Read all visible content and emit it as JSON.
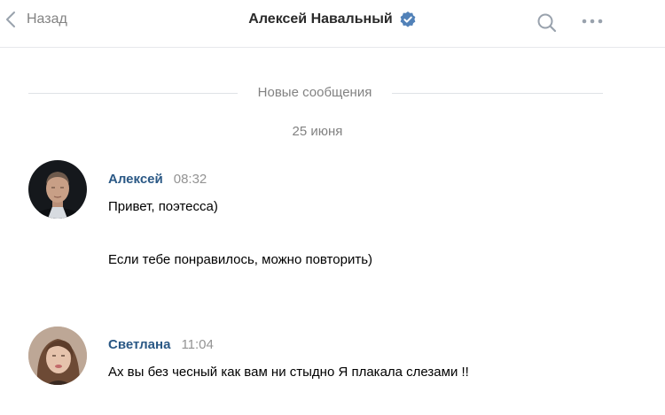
{
  "header": {
    "back_label": "Назад",
    "back_icon": "chevron-left-icon",
    "title": "Алексей Навальный",
    "verified_icon": "verified-badge-icon",
    "search_icon": "search-icon",
    "more_icon": "more-dots-icon"
  },
  "divider": {
    "label": "Новые сообщения"
  },
  "date": "25 июня",
  "messages": [
    {
      "author": "Алексей",
      "time": "08:32",
      "avatar_icon": "avatar",
      "lines": [
        "Привет, поэтесса)",
        "Если тебе понравилось, можно повторить)"
      ]
    },
    {
      "author": "Светлана",
      "time": "11:04",
      "avatar_icon": "avatar",
      "lines": [
        "Ах вы без чесный как вам ни стыдно Я плакала слезами !!"
      ]
    }
  ],
  "colors": {
    "accent": "#5181b8",
    "author": "#2a5885",
    "muted": "#828282",
    "separator": "#dfe2e6"
  }
}
